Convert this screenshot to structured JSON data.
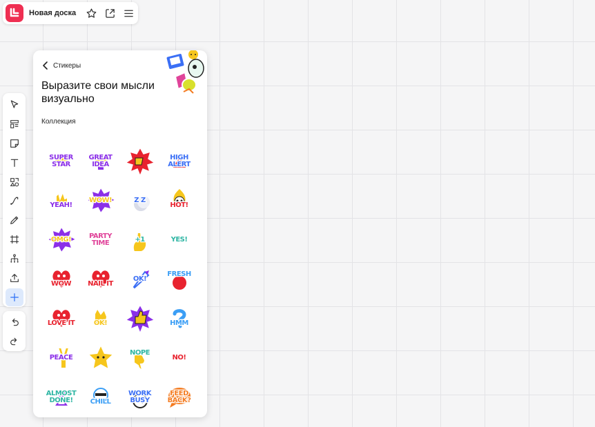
{
  "topbar": {
    "title": "Новая доска",
    "logo_color": "#ef2f52",
    "icons": [
      "star-icon",
      "share-icon",
      "menu-icon"
    ]
  },
  "toolbar": {
    "tools": [
      "select",
      "templates",
      "sticky-note",
      "text",
      "shapes",
      "connector",
      "pen",
      "frame",
      "mindmap",
      "upload",
      "add"
    ],
    "active_tool": "add",
    "history": [
      "undo",
      "redo"
    ]
  },
  "panel": {
    "back_label": "Стикеры",
    "heading": "Выразите свои мысли визуально",
    "collection_label": "Коллекция"
  },
  "stickers": [
    {
      "name": "super-star",
      "text": [
        "SUPER",
        "STAR"
      ],
      "color": "#8b2fe8",
      "icon": "star"
    },
    {
      "name": "great-idea",
      "text": [
        "GREAT",
        "IDEA"
      ],
      "color": "#8b2fe8",
      "icon": "bulb"
    },
    {
      "name": "thumbs-down-burst",
      "text": [],
      "color": "#e8232f",
      "icon": "thumbsdown"
    },
    {
      "name": "high-alert",
      "text": [
        "HIGH",
        "ALERT"
      ],
      "color": "#3b6ff5",
      "icon": "alert"
    },
    {
      "name": "yeah",
      "text": [
        "",
        "YEAH!"
      ],
      "color": "#8b2fe8",
      "icon": "rock"
    },
    {
      "name": "wow-burst",
      "text": [
        "WOW!"
      ],
      "color": "#f6c61c",
      "icon": "burstpurple"
    },
    {
      "name": "sleepy-zzz",
      "text": [
        "Z Z"
      ],
      "color": "#3b6ff5",
      "icon": "moon"
    },
    {
      "name": "hot",
      "text": [
        "",
        "HOT!"
      ],
      "color": "#e8232f",
      "icon": "skull"
    },
    {
      "name": "omg",
      "text": [
        "OMG!"
      ],
      "color": "#f6c61c",
      "icon": "burstpurple"
    },
    {
      "name": "party-time",
      "text": [
        "PARTY",
        "TIME"
      ],
      "color": "#e0449a",
      "icon": "party"
    },
    {
      "name": "plus-one",
      "text": [
        "+1"
      ],
      "color": "#2fb6a4",
      "icon": "finger"
    },
    {
      "name": "yes",
      "text": [
        "YES!"
      ],
      "color": "#2fb6a4",
      "icon": "none"
    },
    {
      "name": "wow-heart",
      "text": [
        "",
        "WOW"
      ],
      "color": "#e8232f",
      "icon": "heart"
    },
    {
      "name": "nail-it",
      "text": [
        "",
        "NAIL IT"
      ],
      "color": "#e8232f",
      "icon": "heart"
    },
    {
      "name": "ok-rocket",
      "text": [
        "OK!"
      ],
      "color": "#3b6ff5",
      "icon": "rocket"
    },
    {
      "name": "fresh",
      "text": [
        "FRESH",
        ""
      ],
      "color": "#3b9ef5",
      "icon": "apple"
    },
    {
      "name": "love-it",
      "text": [
        "",
        "LOVE IT"
      ],
      "color": "#e8232f",
      "icon": "heart"
    },
    {
      "name": "ok-hand",
      "text": [
        "",
        "OK!"
      ],
      "color": "#f6c61c",
      "icon": "okhand"
    },
    {
      "name": "thumbs-up-burst",
      "text": [],
      "color": "#8b2fe8",
      "icon": "thumbsup"
    },
    {
      "name": "hmm",
      "text": [
        "",
        "HMM"
      ],
      "color": "#3b9ef5",
      "icon": "question"
    },
    {
      "name": "peace",
      "text": [
        "PEACE"
      ],
      "color": "#8b2fe8",
      "icon": "peace"
    },
    {
      "name": "star",
      "text": [],
      "color": "#f6c61c",
      "icon": "bigstar"
    },
    {
      "name": "nope",
      "text": [
        "NOPE",
        ""
      ],
      "color": "#2fb6a4",
      "icon": "thumbsdown-y"
    },
    {
      "name": "no",
      "text": [
        "NO!"
      ],
      "color": "#e8232f",
      "icon": "none"
    },
    {
      "name": "almost-done",
      "text": [
        "ALMOST",
        "DONE!"
      ],
      "color": "#2fb6a4",
      "icon": "hourglass"
    },
    {
      "name": "chill",
      "text": [
        "",
        "CHILL"
      ],
      "color": "#3b9ef5",
      "icon": "skull2"
    },
    {
      "name": "work-busy",
      "text": [
        "WORK",
        "BUSY"
      ],
      "color": "#3b6ff5",
      "icon": "clock"
    },
    {
      "name": "feedback",
      "text": [
        "FEED",
        "BACK?"
      ],
      "color": "#f47b20",
      "icon": "bubble"
    }
  ]
}
